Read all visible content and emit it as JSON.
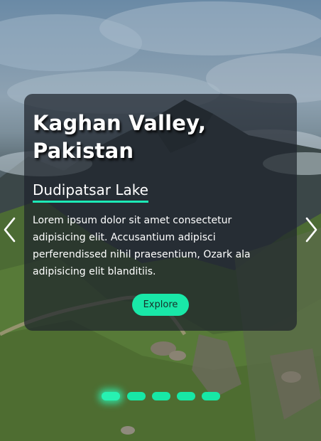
{
  "slide": {
    "title": "Kaghan Valley, Pakistan",
    "subtitle": "Dudipatsar Lake",
    "description": "Lorem ipsum dolor sit amet consectetur adipisicing elit. Accusantium adipisci perferendissed nihil praesentium, Ozark ala adipisicing elit blanditiis.",
    "button_label": "Explore"
  },
  "navigation": {
    "prev_icon": "chevron-left-icon",
    "next_icon": "chevron-right-icon"
  },
  "pagination": {
    "count": 5,
    "active_index": 0
  },
  "colors": {
    "accent": "#1de9b6",
    "card_background": "rgba(30, 36, 44, 0.72)",
    "text": "#ffffff"
  }
}
